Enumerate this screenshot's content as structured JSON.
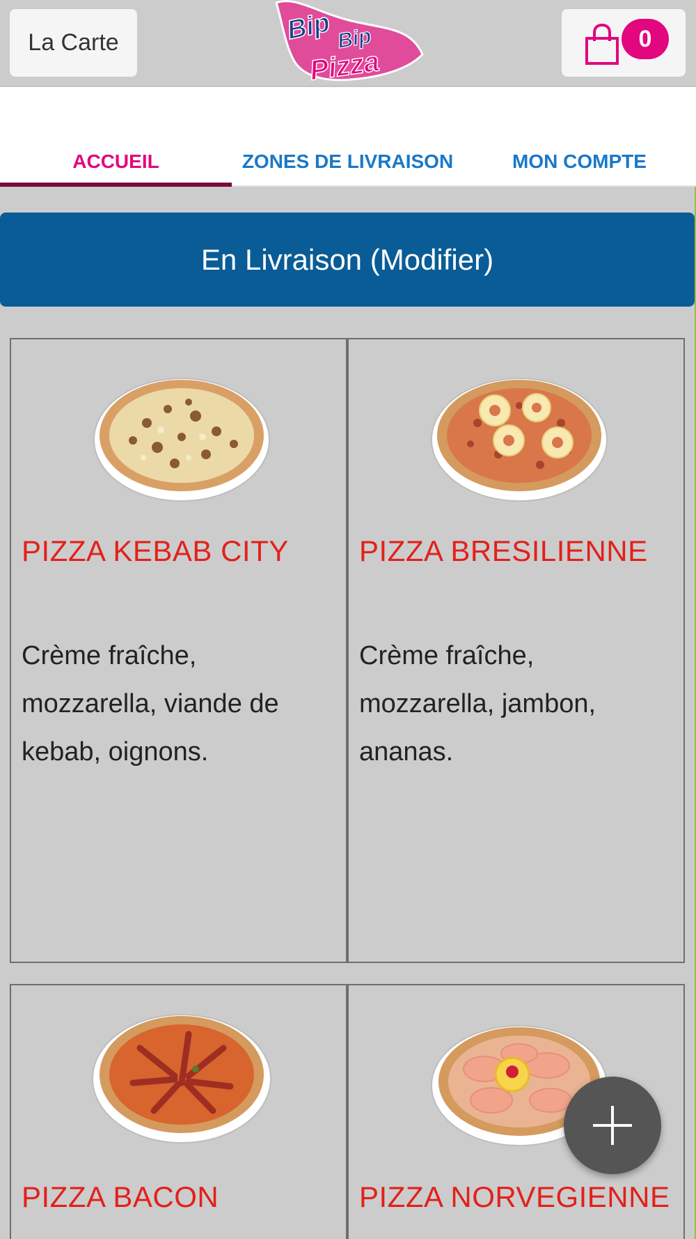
{
  "header": {
    "menu_label": "La Carte",
    "logo_alt": "Bip Bip Pizza",
    "cart_count": "0"
  },
  "tabs": [
    {
      "label": "ACCUEIL",
      "active": true
    },
    {
      "label": "ZONES DE LIVRAISON",
      "active": false
    },
    {
      "label": "MON COMPTE",
      "active": false
    }
  ],
  "delivery_banner": "En Livraison (Modifier)",
  "products": [
    {
      "title": "PIZZA KEBAB CITY",
      "description": "Crème fraîche, mozzarella, viande de kebab, oignons."
    },
    {
      "title": "PIZZA BRESILIENNE",
      "description": "Crème fraîche, mozzarella, jambon, ananas."
    },
    {
      "title": "PIZZA BACON",
      "description": ""
    },
    {
      "title": "PIZZA NORVEGIENNE",
      "description": ""
    }
  ],
  "colors": {
    "accent_pink": "#e2067f",
    "tab_blue": "#1a78c8",
    "banner_blue": "#0a5c96",
    "title_red": "#e3201b"
  },
  "icons": {
    "cart": "shopping-bag-icon",
    "fab": "plus-icon"
  }
}
